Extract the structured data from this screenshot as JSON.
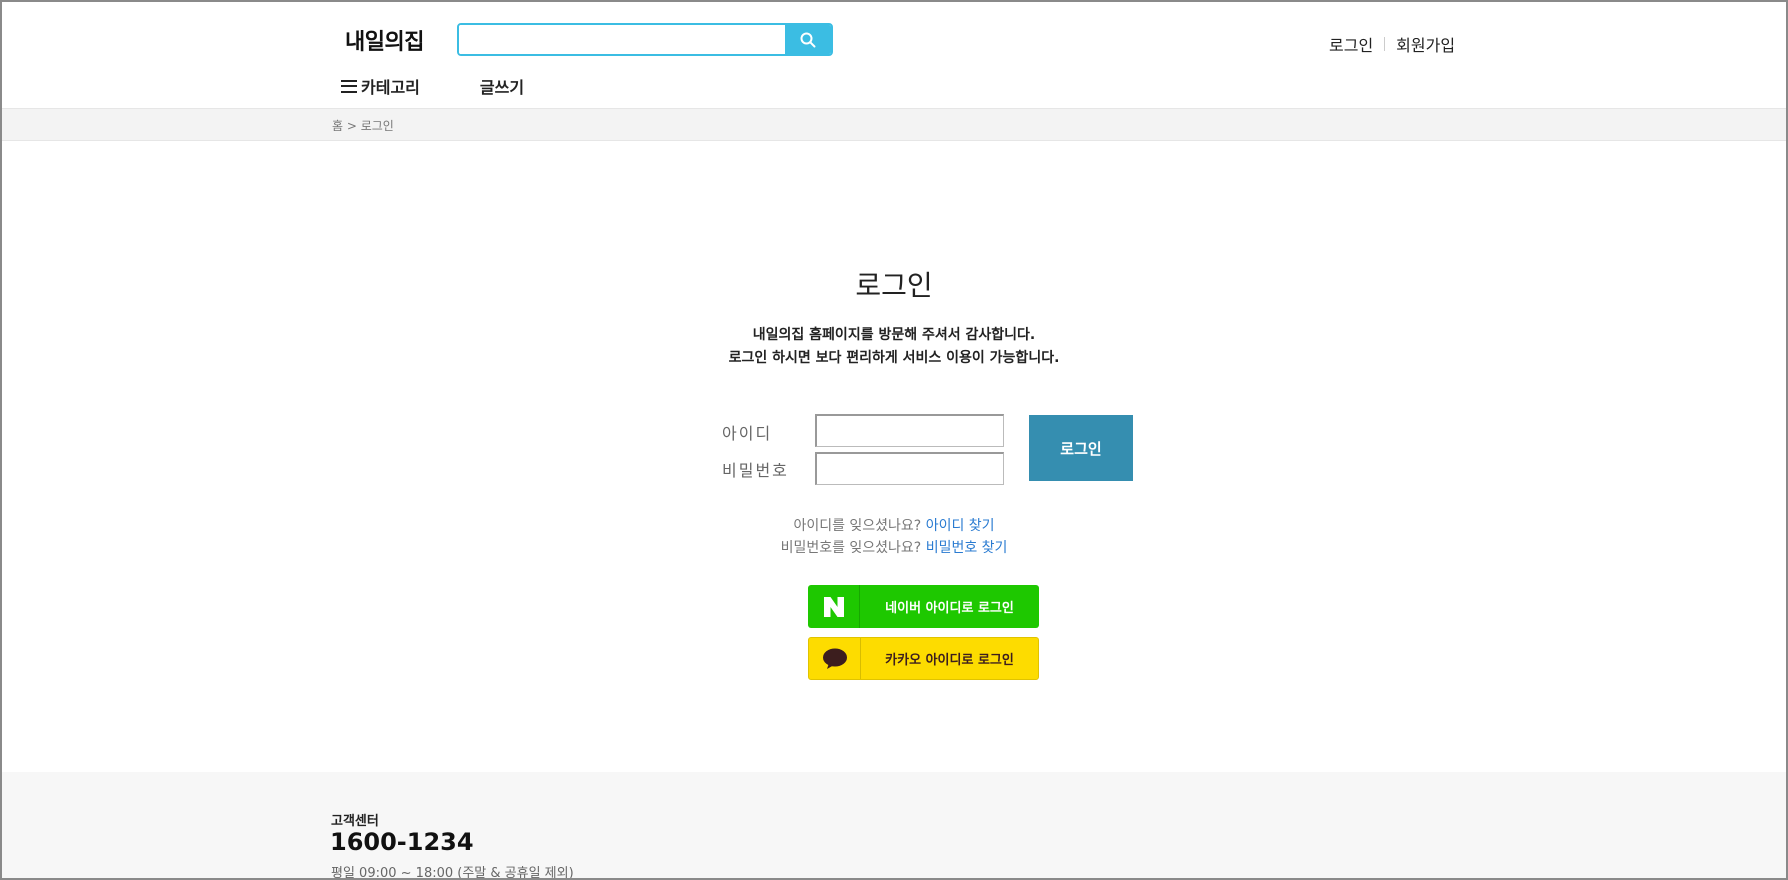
{
  "header": {
    "logo": "내일의집",
    "search_placeholder": "",
    "search_value": "",
    "links": {
      "login": "로그인",
      "signup": "회원가입"
    },
    "nav": {
      "category": "카테고리",
      "write": "글쓰기"
    }
  },
  "breadcrumb": "홈 > 로그인",
  "login": {
    "title": "로그인",
    "desc_line1": "내일의집 홈페이지를 방문해 주셔서 감사합니다.",
    "desc_line2": "로그인 하시면 보다 편리하게 서비스 이용이 가능합니다.",
    "id_label": "아이디",
    "pw_label": "비밀번호",
    "id_value": "",
    "pw_value": "",
    "submit_label": "로그인",
    "find_id_prompt": "아이디를 잊으셨나요?",
    "find_id_link": "아이디 찾기",
    "find_pw_prompt": "비밀번호를 잊으셨나요?",
    "find_pw_link": "비밀번호 찾기",
    "naver_label": "네이버 아이디로 로그인",
    "kakao_label": "카카오 아이디로 로그인"
  },
  "footer": {
    "cs_label": "고객센터",
    "cs_phone": "1600-1234",
    "cs_hours": "평일 09:00 ~ 18:00 (주말 & 공휴일 제외)"
  },
  "icons": {
    "search": "search-icon",
    "menu": "hamburger-icon",
    "naver": "naver-logo-icon",
    "kakao": "kakao-speech-bubble-icon"
  },
  "colors": {
    "search_accent": "#3bbde3",
    "login_button": "#358eb0",
    "link": "#2a7bd1",
    "naver": "#1ec800",
    "kakao": "#fddc00"
  }
}
